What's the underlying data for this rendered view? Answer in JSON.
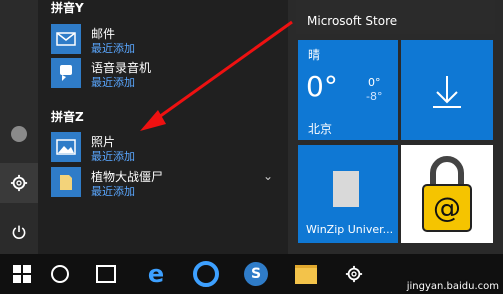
{
  "app_list": {
    "section_y": "拼音Y",
    "section_z": "拼音Z",
    "apps": [
      {
        "name": "邮件",
        "status": "最近添加",
        "icon": "mail-icon"
      },
      {
        "name": "语音录音机",
        "status": "最近添加",
        "icon": "microphone-icon"
      },
      {
        "name": "照片",
        "status": "最近添加",
        "icon": "photos-icon"
      },
      {
        "name": "植物大战僵尸",
        "status": "最近添加",
        "icon": "folder-icon"
      }
    ]
  },
  "tiles": {
    "store": "Microsoft Store",
    "weather": {
      "condition": "晴",
      "temp": "0°",
      "high": "0°",
      "low": "-8°",
      "city": "北京"
    },
    "winzip": "WinZip Univer..."
  },
  "colors": {
    "accent": "#2f7cc8",
    "tile_blue": "#0f78d4",
    "link": "#5aa7ff",
    "keepass_yellow": "#f5c400"
  },
  "watermark": "jingyan.baidu.com"
}
